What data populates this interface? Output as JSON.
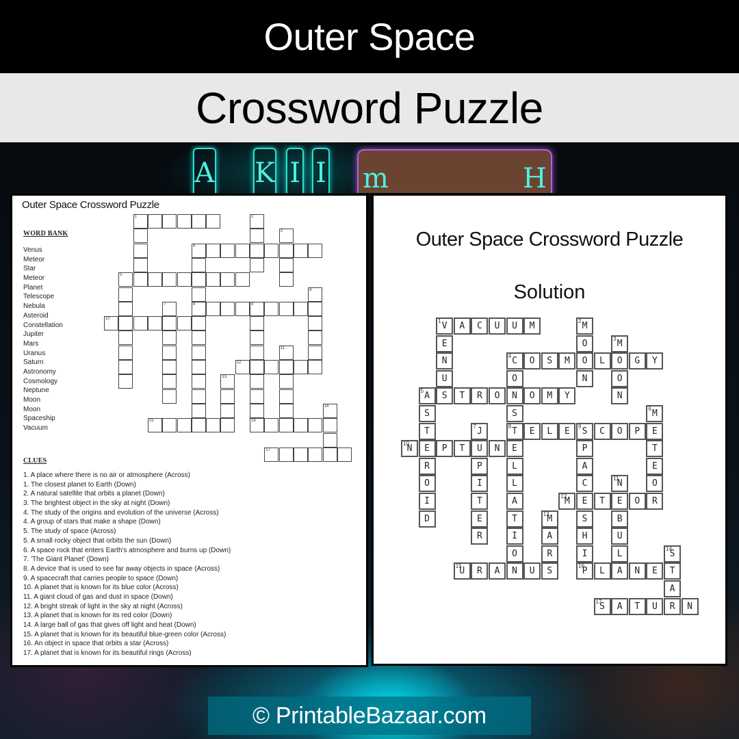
{
  "header": {
    "title": "Outer Space",
    "subtitle": "Crossword Puzzle"
  },
  "decoration": {
    "neon_letters": [
      "A",
      "K",
      "I",
      "I",
      "m",
      "H"
    ]
  },
  "worksheet": {
    "title": "Outer Space Crossword Puzzle",
    "word_bank_heading": "WORD BANK",
    "word_bank": [
      "Venus",
      "Meteor",
      "Star",
      "Meteor",
      "Planet",
      "Telescope",
      "Nebula",
      "Asteroid",
      "Constellation",
      "Jupiter",
      "Mars",
      "Uranus",
      "Saturn",
      "Astronomy",
      "Cosmology",
      "Neptune",
      "Moon",
      "Moon",
      "Spaceship",
      "Vacuum"
    ],
    "clues_heading": "CLUES",
    "clues": [
      "1. A place where there is no air or atmosphere (Across)",
      "1. The closest planet to Earth (Down)",
      "2. A natural satellite that orbits a planet (Down)",
      "3. The brightest object in the sky at night (Down)",
      "4. The study of the origins and evolution of the universe (Across)",
      "4. A group of stars that make a shape (Down)",
      "5. The study of space (Across)",
      "5. A small rocky object that orbits the sun (Down)",
      "6. A space rock that enters Earth's atmosphere and burns up (Down)",
      "7. 'The Giant Planet' (Down)",
      "8. A device that is used to see far away objects in space (Across)",
      "9. A spacecraft that carries people to space (Down)",
      "10. A planet that is known for its blue color (Across)",
      "11. A giant cloud of gas and dust in space (Down)",
      "12. A bright streak of light in the sky at night (Across)",
      "13. A planet that is known for its red color (Down)",
      "14. A large ball of gas that gives off light and heat (Down)",
      "15. A planet that is known for its beautiful blue-green color (Across)",
      "16. An object in space that orbits a star (Across)",
      "17. A planet that is known for its beautiful rings (Across)"
    ]
  },
  "solution": {
    "title": "Outer Space Crossword Puzzle",
    "subtitle": "Solution"
  },
  "crossword": {
    "words": [
      {
        "num": 1,
        "dir": "across",
        "row": 0,
        "col": 2,
        "answer": "VACUUM"
      },
      {
        "num": 1,
        "dir": "down",
        "row": 0,
        "col": 2,
        "answer": "VENUS"
      },
      {
        "num": 2,
        "dir": "down",
        "row": 0,
        "col": 10,
        "answer": "MOON"
      },
      {
        "num": 3,
        "dir": "down",
        "row": 1,
        "col": 12,
        "answer": "MOON"
      },
      {
        "num": 4,
        "dir": "across",
        "row": 2,
        "col": 6,
        "answer": "COSMOLOGY"
      },
      {
        "num": 4,
        "dir": "down",
        "row": 2,
        "col": 6,
        "answer": "CONSTELLATION"
      },
      {
        "num": 5,
        "dir": "across",
        "row": 4,
        "col": 1,
        "answer": "ASTRONOMY"
      },
      {
        "num": 5,
        "dir": "down",
        "row": 4,
        "col": 1,
        "answer": "ASTEROID"
      },
      {
        "num": 6,
        "dir": "down",
        "row": 5,
        "col": 14,
        "answer": "METEOR"
      },
      {
        "num": 7,
        "dir": "down",
        "row": 6,
        "col": 4,
        "answer": "JUPITER"
      },
      {
        "num": 8,
        "dir": "across",
        "row": 6,
        "col": 6,
        "answer": "TELESCOPE"
      },
      {
        "num": 9,
        "dir": "down",
        "row": 6,
        "col": 10,
        "answer": "SPACESHIP"
      },
      {
        "num": 10,
        "dir": "across",
        "row": 7,
        "col": 0,
        "answer": "NEPTUNE"
      },
      {
        "num": 11,
        "dir": "down",
        "row": 9,
        "col": 12,
        "answer": "NEBULA"
      },
      {
        "num": 12,
        "dir": "across",
        "row": 10,
        "col": 9,
        "answer": "METEOR"
      },
      {
        "num": 13,
        "dir": "down",
        "row": 11,
        "col": 8,
        "answer": "MARS"
      },
      {
        "num": 14,
        "dir": "down",
        "row": 13,
        "col": 15,
        "answer": "STAR"
      },
      {
        "num": 15,
        "dir": "across",
        "row": 14,
        "col": 3,
        "answer": "URANUS"
      },
      {
        "num": 16,
        "dir": "across",
        "row": 14,
        "col": 10,
        "answer": "PLANET"
      },
      {
        "num": 17,
        "dir": "across",
        "row": 16,
        "col": 11,
        "answer": "SATURN"
      }
    ]
  },
  "footer": {
    "copyright": "© PrintableBazaar.com"
  }
}
